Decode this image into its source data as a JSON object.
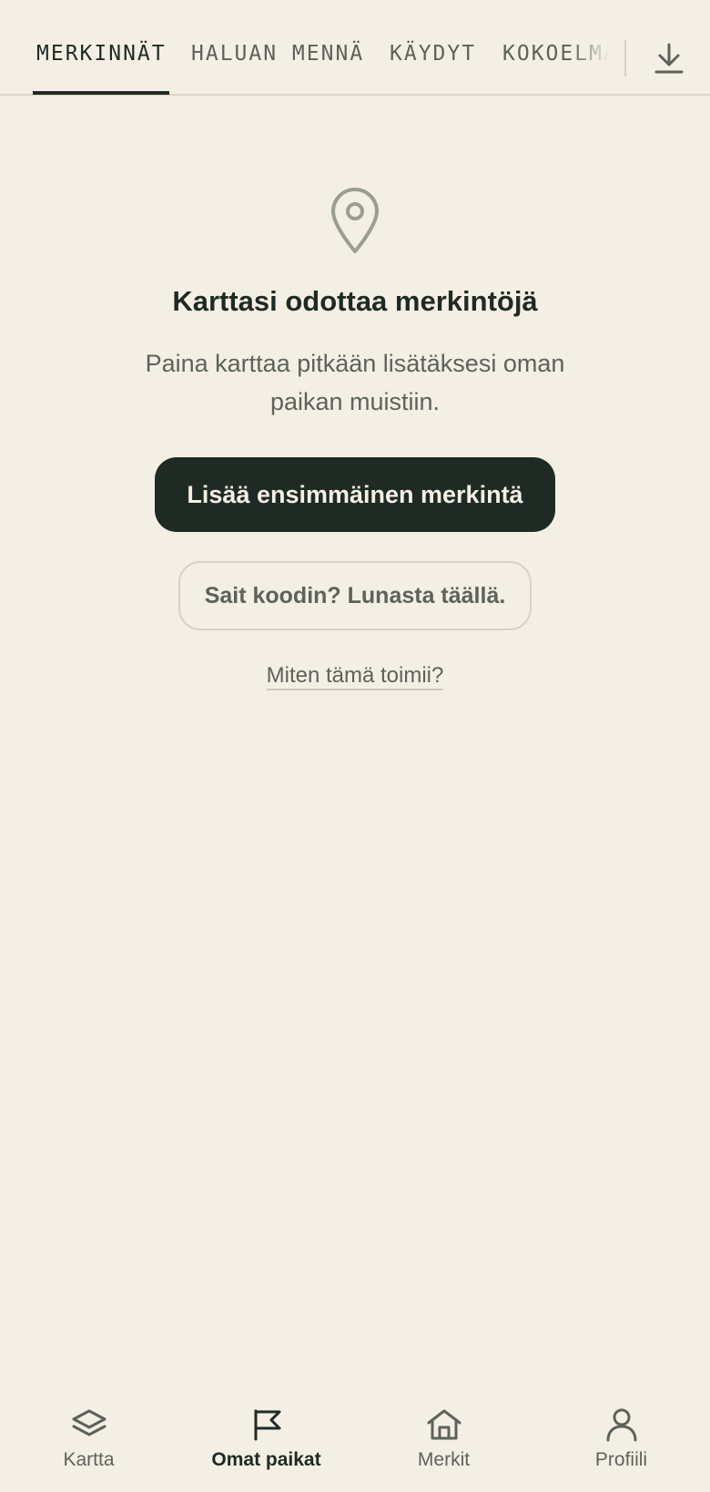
{
  "tabs": {
    "items": [
      {
        "label": "MERKINNÄT",
        "active": true
      },
      {
        "label": "HALUAN MENNÄ",
        "active": false
      },
      {
        "label": "KÄYDYT",
        "active": false
      },
      {
        "label": "KOKOELMAT",
        "active": false
      }
    ],
    "download_icon": "download-icon"
  },
  "empty_state": {
    "icon": "map-pin-icon",
    "title": "Karttasi odottaa merkintöjä",
    "description": "Paina karttaa pitkään lisätäksesi oman paikan muistiin.",
    "primary_button": "Lisää ensimmäinen merkintä",
    "secondary_button": "Sait koodin? Lunasta täällä.",
    "help_link": "Miten tämä toimii?"
  },
  "bottom_nav": {
    "items": [
      {
        "label": "Kartta",
        "icon": "layers-icon",
        "active": false
      },
      {
        "label": "Omat paikat",
        "icon": "flag-icon",
        "active": true
      },
      {
        "label": "Merkit",
        "icon": "home-icon",
        "active": false
      },
      {
        "label": "Profiili",
        "icon": "user-icon",
        "active": false
      }
    ]
  },
  "colors": {
    "background": "#f4efe4",
    "primary": "#1f2a25",
    "muted_text": "#5d625b",
    "border": "#d6d2c4",
    "icon_muted": "#9a9d92"
  }
}
